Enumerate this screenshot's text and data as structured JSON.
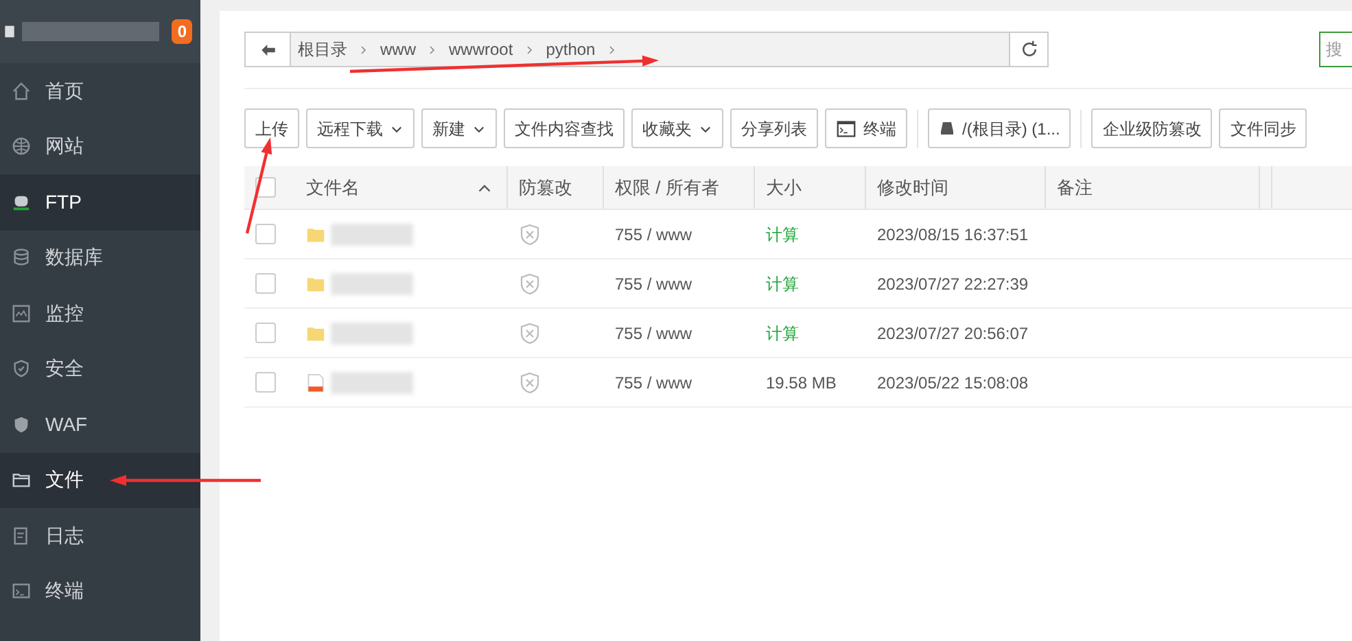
{
  "sidebar": {
    "badge": "0",
    "items": [
      {
        "label": "首页",
        "selected": false
      },
      {
        "label": "网站",
        "selected": false
      },
      {
        "label": "FTP",
        "selected": true
      },
      {
        "label": "数据库",
        "selected": false
      },
      {
        "label": "监控",
        "selected": false
      },
      {
        "label": "安全",
        "selected": false
      },
      {
        "label": "WAF",
        "selected": false
      },
      {
        "label": "文件",
        "selected": true
      },
      {
        "label": "日志",
        "selected": false
      },
      {
        "label": "终端",
        "selected": false
      }
    ]
  },
  "breadcrumb": [
    "根目录",
    "www",
    "wwwroot",
    "python"
  ],
  "search": {
    "placeholder": "搜"
  },
  "toolbar": [
    {
      "label": "上传",
      "kind": "button"
    },
    {
      "label": "远程下载",
      "kind": "dropdown"
    },
    {
      "label": "新建",
      "kind": "dropdown"
    },
    {
      "label": "文件内容查找",
      "kind": "button"
    },
    {
      "label": "收藏夹",
      "kind": "dropdown"
    },
    {
      "label": "分享列表",
      "kind": "button"
    },
    {
      "label": "终端",
      "kind": "terminal"
    },
    {
      "label": "/(根目录) (1...",
      "kind": "disk"
    },
    {
      "label": "企业级防篡改",
      "kind": "button"
    },
    {
      "label": "文件同步",
      "kind": "button"
    }
  ],
  "table": {
    "all_checked": false,
    "columns": [
      "文件名",
      "防篡改",
      "权限 / 所有者",
      "大小",
      "修改时间",
      "备注"
    ],
    "rows": [
      {
        "kind": "folder",
        "checked": false,
        "permission": "755 / www",
        "size": "计算",
        "modified": "2023/08/15 16:37:51"
      },
      {
        "kind": "folder",
        "checked": false,
        "permission": "755 / www",
        "size": "计算",
        "modified": "2023/07/27 22:27:39"
      },
      {
        "kind": "folder",
        "checked": false,
        "permission": "755 / www",
        "size": "计算",
        "modified": "2023/07/27 20:56:07"
      },
      {
        "kind": "archive",
        "checked": false,
        "permission": "755 / www",
        "size": "19.58 MB",
        "modified": "2023/05/22 15:08:08"
      }
    ]
  }
}
